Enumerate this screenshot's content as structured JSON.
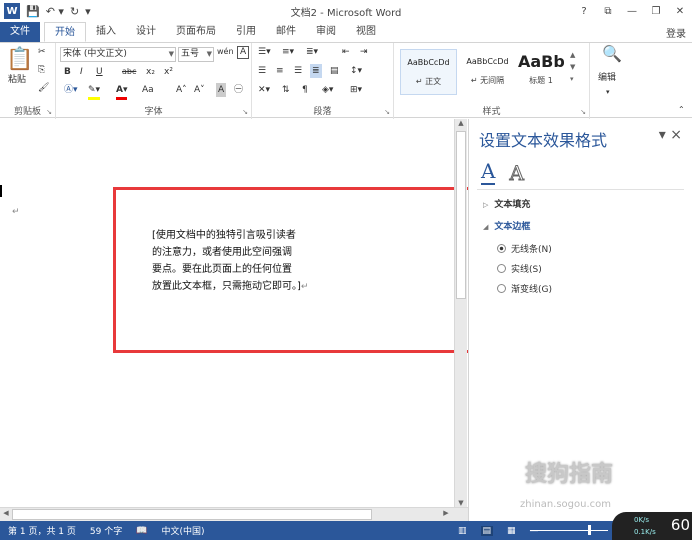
{
  "window": {
    "title": "文档2 - Microsoft Word",
    "buttons": [
      "?",
      "⧉",
      "—",
      "❐",
      "✕"
    ]
  },
  "quick_access": [
    "save-icon",
    "undo-icon",
    "redo-icon"
  ],
  "tabs": [
    {
      "label": "文件",
      "file": true
    },
    {
      "label": "开始",
      "active": true
    },
    {
      "label": "插入"
    },
    {
      "label": "设计"
    },
    {
      "label": "页面布局"
    },
    {
      "label": "引用"
    },
    {
      "label": "邮件"
    },
    {
      "label": "审阅"
    },
    {
      "label": "视图"
    }
  ],
  "account": "登录",
  "ribbon": {
    "clipboard": {
      "label": "剪贴板",
      "paste": "粘贴"
    },
    "font": {
      "label": "字体",
      "font_name": "宋体 (中文正文)",
      "font_size": "五号",
      "bold": "B",
      "italic": "I",
      "underline": "U",
      "strike": "abc",
      "sub": "x₂",
      "sup": "x²",
      "change_case": "Aa",
      "grow": "A˄",
      "shrink": "A˅",
      "phonetic": "wén",
      "border": "A"
    },
    "paragraph": {
      "label": "段落"
    },
    "styles": {
      "label": "样式",
      "items": [
        {
          "preview": "AaBbCcDd",
          "name": "↵ 正文"
        },
        {
          "preview": "AaBbCcDd",
          "name": "↵ 无间隔"
        },
        {
          "preview": "AaBb",
          "name": "标题 1"
        }
      ]
    },
    "editing": {
      "label": "编辑"
    }
  },
  "document": {
    "paragraph_mark": "↵",
    "quote_lines": [
      "[使用文档中的独特引言吸引读者",
      "的注意力，或者使用此空间强调",
      "要点。要在此页面上的任何位置",
      "放置此文本框，只需拖动它即可。]"
    ]
  },
  "pane": {
    "title": "设置文本效果格式",
    "close": "×",
    "tab_fill": "A",
    "tab_outline": "A",
    "sections": [
      {
        "label": "文本填充",
        "expanded": false
      },
      {
        "label": "文本边框",
        "expanded": true
      }
    ],
    "options": [
      {
        "label": "无线条(N)",
        "selected": true
      },
      {
        "label": "实线(S)",
        "selected": false
      },
      {
        "label": "渐变线(G)",
        "selected": false
      }
    ]
  },
  "status": {
    "page": "第 1 页，共 1 页",
    "words": "59 个字",
    "language": "中文(中国)",
    "zoom": "60",
    "net_up": "0K/s",
    "net_down": "0.1K/s"
  },
  "watermark": {
    "text": "搜狗指南",
    "sub": "zhinan.sogou.com"
  },
  "colors": {
    "accent": "#2b579a",
    "highlight_box": "#e8393b"
  }
}
